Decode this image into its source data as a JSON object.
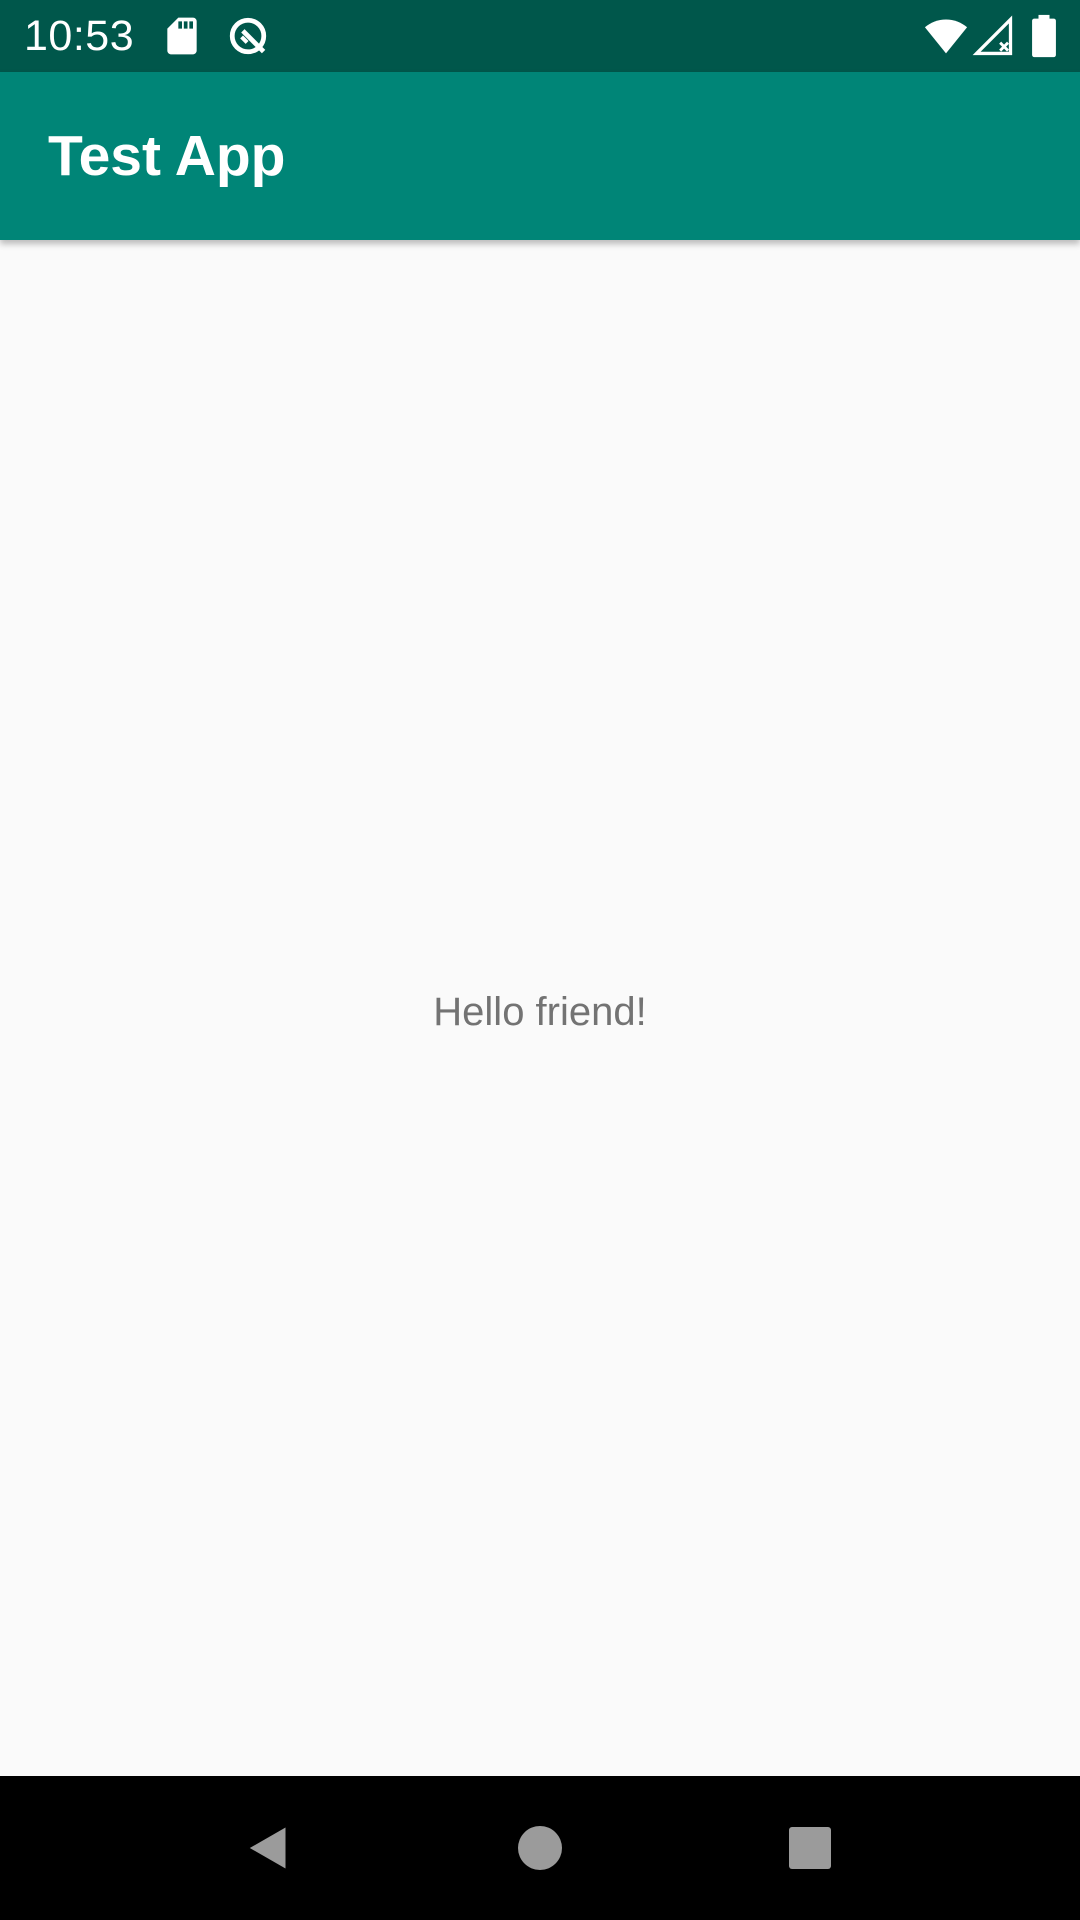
{
  "status_bar": {
    "time": "10:53",
    "left_icons": [
      "sd-card-icon",
      "data-saver-icon"
    ],
    "right_icons": [
      "wifi-icon",
      "cell-signal-no-data-icon",
      "battery-icon"
    ],
    "background_color": "#00574b"
  },
  "app_bar": {
    "title": "Test App",
    "background_color": "#008577"
  },
  "content": {
    "message": "Hello friend!",
    "background_color": "#fafafa"
  },
  "nav_bar": {
    "buttons": [
      "back-icon",
      "home-icon",
      "recents-icon"
    ],
    "background_color": "#000000"
  }
}
